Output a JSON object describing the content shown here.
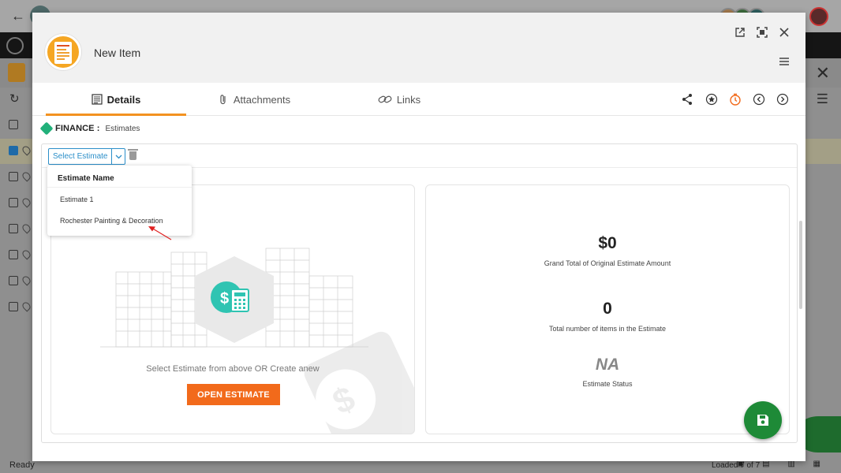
{
  "background": {
    "status_text": "Ready",
    "loaded_text": "Loaded 7 of 7"
  },
  "modal": {
    "title": "New Item",
    "tabs": [
      {
        "label": "Details",
        "icon": "list-doc-icon",
        "active": true
      },
      {
        "label": "Attachments",
        "icon": "paperclip-icon",
        "active": false
      },
      {
        "label": "Links",
        "icon": "link-icon",
        "active": false
      }
    ],
    "breadcrumb": {
      "section": "FINANCE :",
      "page": "Estimates"
    },
    "toolbar": {
      "select_label": "Select Estimate"
    },
    "dropdown": {
      "header": "Estimate Name",
      "items": [
        "Estimate 1",
        "Rochester Painting & Decoration"
      ]
    },
    "left_card": {
      "hint": "Select Estimate from above OR Create anew",
      "open_button": "OPEN ESTIMATE"
    },
    "stats": {
      "grand_total_value": "$0",
      "grand_total_label": "Grand Total of Original Estimate Amount",
      "items_value": "0",
      "items_label": "Total number of items in the Estimate",
      "status_value": "NA",
      "status_label": "Estimate Status"
    }
  },
  "colors": {
    "accent_orange": "#f39220",
    "button_orange": "#f26a1b",
    "select_blue": "#2c8fc9",
    "save_green": "#1e8a37",
    "finance_teal": "#21b07a"
  }
}
